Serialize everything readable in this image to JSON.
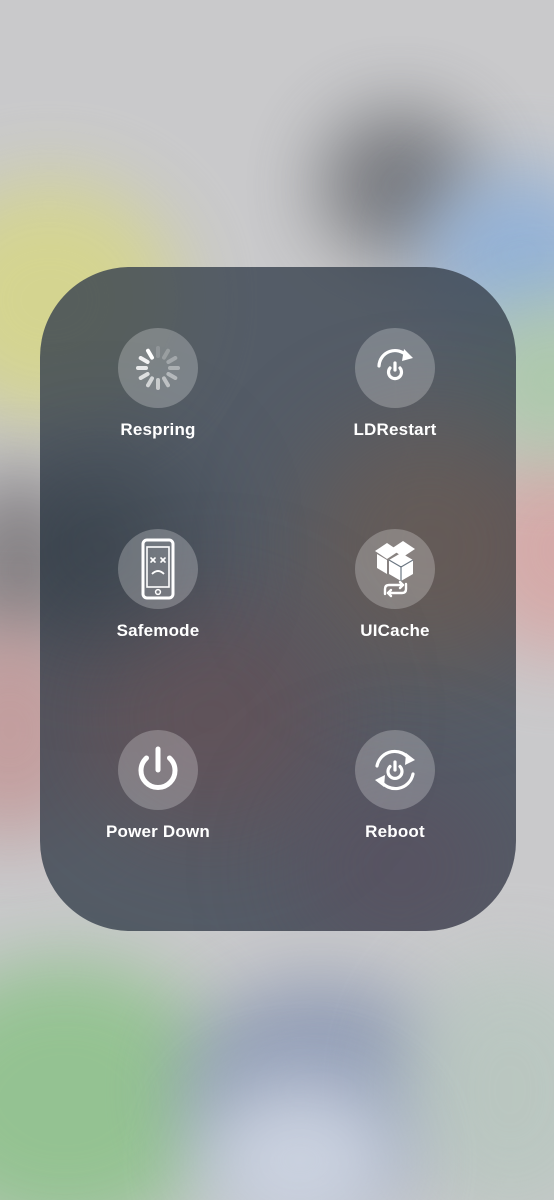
{
  "actions": [
    {
      "label": "Respring",
      "icon": "spinner-icon",
      "interactable": true
    },
    {
      "label": "LDRestart",
      "icon": "restart-icon",
      "interactable": true
    },
    {
      "label": "Safemode",
      "icon": "sad-phone-icon",
      "interactable": true
    },
    {
      "label": "UICache",
      "icon": "box-refresh-icon",
      "interactable": true
    },
    {
      "label": "Power Down",
      "icon": "power-icon",
      "interactable": true
    },
    {
      "label": "Reboot",
      "icon": "reboot-icon",
      "interactable": true
    }
  ],
  "colors": {
    "panel": "#3a4450",
    "button_fill": "rgba(255,255,255,0.24)",
    "label": "#ffffff"
  }
}
